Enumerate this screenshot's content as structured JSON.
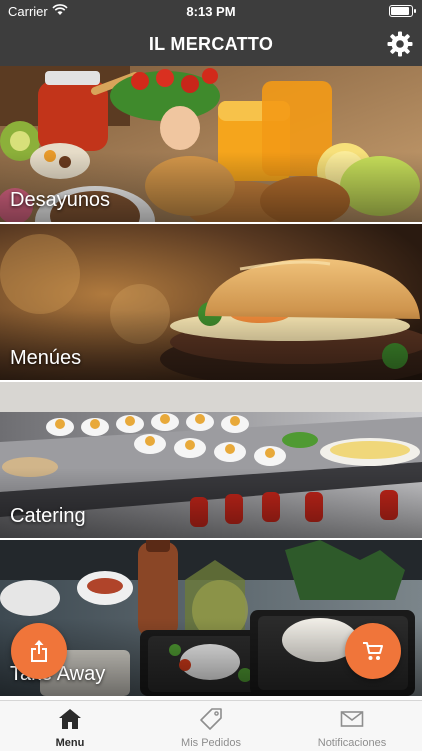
{
  "status_bar": {
    "carrier": "Carrier",
    "time": "8:13 PM"
  },
  "header": {
    "title": "IL MERCATTO",
    "settings_icon": "gear-icon"
  },
  "menu": {
    "items": [
      {
        "label": "Desayunos"
      },
      {
        "label": "Menúes"
      },
      {
        "label": "Catering"
      },
      {
        "label": "Take Away"
      }
    ]
  },
  "fabs": {
    "left_icon": "share-icon",
    "right_icon": "cart-icon",
    "accent": "#f0753a"
  },
  "tab_bar": {
    "tabs": [
      {
        "label": "Menu",
        "icon": "home-icon",
        "active": true
      },
      {
        "label": "Mis Pedidos",
        "icon": "tag-icon",
        "active": false
      },
      {
        "label": "Notificaciones",
        "icon": "mail-icon",
        "active": false
      }
    ]
  },
  "colors": {
    "header_bg": "#3d3d3d",
    "tab_bar_bg": "#f7f7f7"
  }
}
